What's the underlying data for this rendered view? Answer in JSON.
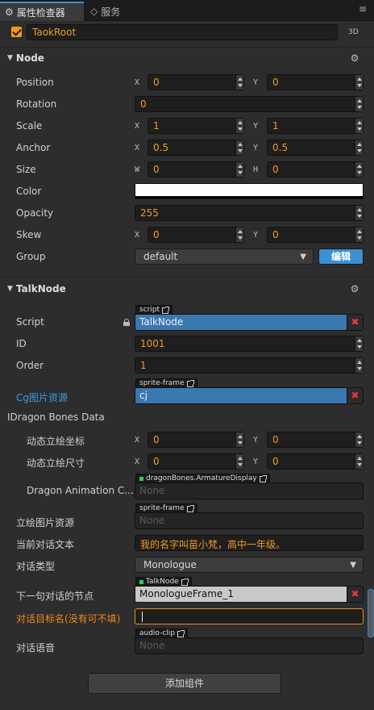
{
  "tabs": [
    {
      "label": "属性检查器",
      "icon": "gear-icon"
    },
    {
      "label": "服务",
      "icon": "diamond-icon"
    }
  ],
  "node_header": {
    "active": true,
    "name": "TaokRoot",
    "mode": "3D"
  },
  "node_section": {
    "title": "Node",
    "props": {
      "position": {
        "label": "Position",
        "x": "0",
        "y": "0"
      },
      "rotation": {
        "label": "Rotation",
        "value": "0"
      },
      "scale": {
        "label": "Scale",
        "x": "1",
        "y": "1"
      },
      "anchor": {
        "label": "Anchor",
        "x": "0.5",
        "y": "0.5"
      },
      "size": {
        "label": "Size",
        "w": "0",
        "h": "0"
      },
      "color": {
        "label": "Color",
        "value": "#ffffff"
      },
      "opacity": {
        "label": "Opacity",
        "value": "255"
      },
      "skew": {
        "label": "Skew",
        "x": "0",
        "y": "0"
      },
      "group": {
        "label": "Group",
        "value": "default",
        "edit_label": "编辑"
      }
    }
  },
  "axis_labels": {
    "x": "X",
    "y": "Y",
    "w": "W",
    "h": "H"
  },
  "talk_section": {
    "title": "TalkNode",
    "script": {
      "label": "Script",
      "tag": "script",
      "value": "TalkNode"
    },
    "id": {
      "label": "ID",
      "value": "1001"
    },
    "order": {
      "label": "Order",
      "value": "1"
    },
    "cg": {
      "label": "Cg图片资源",
      "tag": "sprite-frame",
      "value": "cj"
    },
    "dragon_group": {
      "label": "IDragon Bones Data"
    },
    "pos": {
      "label": "动态立绘坐标",
      "x": "0",
      "y": "0"
    },
    "size": {
      "label": "动态立绘尺寸",
      "x": "0",
      "y": "0"
    },
    "dragon_anim": {
      "label": "Dragon Animation C...",
      "tag": "dragonBones.ArmatureDisplay",
      "value": "None"
    },
    "pic": {
      "label": "立绘图片资源",
      "tag": "sprite-frame",
      "value": "None"
    },
    "text": {
      "label": "当前对话文本",
      "value": "我的名字叫苗小梵，高中一年级。"
    },
    "type": {
      "label": "对话类型",
      "value": "Monologue"
    },
    "next": {
      "label": "下一句对话的节点",
      "tag": "TalkNode",
      "value": "MonologueFrame_1"
    },
    "target": {
      "label": "对话目标名(没有可不填)",
      "value": ""
    },
    "audio": {
      "label": "对话语音",
      "tag": "audio-clip",
      "value": "None"
    }
  },
  "add_component": "添加组件",
  "colors": {
    "accent": "#3c8fd2",
    "value": "#f09a2a",
    "remove": "#e23a3a"
  }
}
